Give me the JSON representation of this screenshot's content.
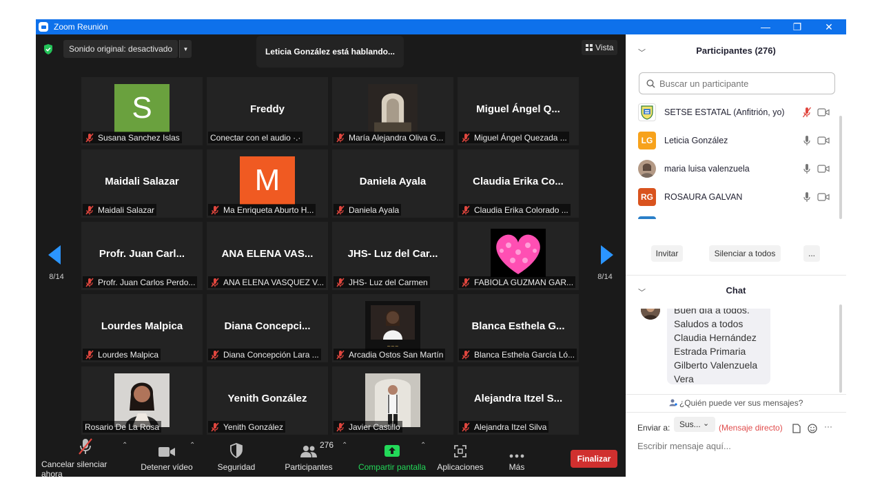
{
  "window": {
    "title": "Zoom Reunión",
    "minimize_glyph": "—",
    "restore_glyph": "❐",
    "close_glyph": "✕"
  },
  "meeting": {
    "sound_original": "Sonido original: desactivado",
    "speaking_banner": "Leticia González está hablando...",
    "view_label": "Vista",
    "page_left": "8/14",
    "page_right": "8/14",
    "tiles": [
      {
        "display": "S",
        "avatar_color": "#6aa13e",
        "label": "Susana Sanchez Islas",
        "mic_off": true
      },
      {
        "display": "Freddy",
        "label": "Conectar con el audio ·.·",
        "mic_off": false
      },
      {
        "display": "photo-arch",
        "label": "María Alejandra Oliva G...",
        "mic_off": true
      },
      {
        "display": "Miguel Ángel Q...",
        "label": "Miguel Ángel Quezada ...",
        "mic_off": true
      },
      {
        "display": "Maidali Salazar",
        "label": "Maidali Salazar",
        "mic_off": true
      },
      {
        "display": "M",
        "avatar_color": "#f05a22",
        "label": "Ma Enriqueta Aburto H...",
        "mic_off": true
      },
      {
        "display": "Daniela Ayala",
        "label": "Daniela Ayala",
        "mic_off": true
      },
      {
        "display": "Claudia Erika Co...",
        "label": "Claudia Erika Colorado ...",
        "mic_off": true
      },
      {
        "display": "Profr. Juan Carl...",
        "label": "Profr. Juan Carlos Perdo...",
        "mic_off": true
      },
      {
        "display": "ANA ELENA VAS...",
        "label": "ANA ELENA VASQUEZ V...",
        "mic_off": true
      },
      {
        "display": "JHS- Luz del Car...",
        "label": "JHS- Luz del Carmen",
        "mic_off": true
      },
      {
        "display": "photo-heart",
        "label": "FABIOLA GUZMAN GAR...",
        "mic_off": true
      },
      {
        "display": "Lourdes Malpica",
        "label": "Lourdes Malpica",
        "mic_off": true
      },
      {
        "display": "Diana Concepci...",
        "label": "Diana Concepción Lara ...",
        "mic_off": true
      },
      {
        "display": "photo-woman",
        "label": "Arcadia Ostos San Martín",
        "mic_off": true
      },
      {
        "display": "Blanca Esthela G...",
        "label": "Blanca Esthela García Ló...",
        "mic_off": true
      },
      {
        "display": "photo-portrait",
        "label": "Rosario De La Rosa",
        "mic_off": false
      },
      {
        "display": "Yenith González",
        "label": "Yenith González",
        "mic_off": true
      },
      {
        "display": "photo-man",
        "label": "Javier Castillo",
        "mic_off": true
      },
      {
        "display": "Alejandra Itzel S...",
        "label": "Alejandra Itzel Silva",
        "mic_off": true
      }
    ]
  },
  "toolbar": {
    "unmute": "Cancelar silenciar ahora",
    "stop_video": "Detener vídeo",
    "security": "Seguridad",
    "participants": "Participantes",
    "participants_count": "276",
    "share": "Compartir pantalla",
    "apps": "Aplicaciones",
    "more": "Más",
    "end": "Finalizar"
  },
  "participants_panel": {
    "title": "Participantes (276)",
    "search_placeholder": "Buscar un participante",
    "items": [
      {
        "name": "SETSE ESTATAL (Anfitrión, yo)",
        "avatar": "logo",
        "mic_muted": true
      },
      {
        "name": "Leticia González",
        "avatar": "LG",
        "avatar_color": "#f7a21b",
        "mic_muted": false
      },
      {
        "name": "maria luisa valenzuela",
        "avatar": "photo",
        "mic_muted": false
      },
      {
        "name": "ROSAURA GALVAN",
        "avatar": "RG",
        "avatar_color": "#d9531e",
        "mic_muted": false
      }
    ],
    "invite": "Invitar",
    "mute_all": "Silenciar a todos",
    "more": "..."
  },
  "chat": {
    "title": "Chat",
    "partial_line": "Buen día a todos.",
    "message_lines": [
      "Saludos a todos",
      "Claudia Hernández",
      "Estrada Primaria",
      "Gilberto Valenzuela",
      "Vera"
    ],
    "who_can_see": "¿Quién puede ver sus mensajes?",
    "send_to_label": "Enviar a:",
    "send_to_value": "Sus...",
    "direct_message": "(Mensaje directo)",
    "input_placeholder": "Escribir mensaje aquí...",
    "more": "···"
  },
  "colors": {
    "accent_blue": "#0e71eb",
    "arrow_blue": "#2b95ff",
    "end_red": "#d0302f",
    "share_green": "#23d959",
    "muted_red": "#e0463e"
  }
}
